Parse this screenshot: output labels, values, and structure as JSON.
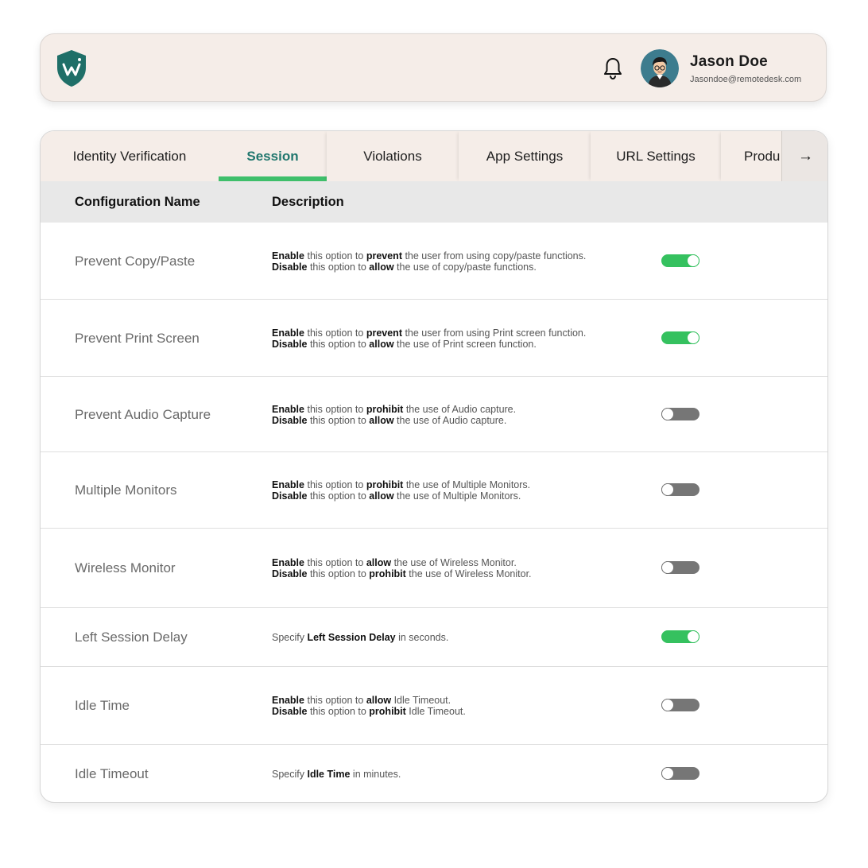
{
  "header": {
    "logo_icon": "shield-w-logo",
    "notification_icon": "bell-icon",
    "user": {
      "name": "Jason Doe",
      "email": "Jasondoe@remotedesk.com"
    }
  },
  "tabs": [
    {
      "label": "Identity Verification",
      "active": false
    },
    {
      "label": "Session",
      "active": true
    },
    {
      "label": "Violations",
      "active": false
    },
    {
      "label": "App Settings",
      "active": false
    },
    {
      "label": "URL Settings",
      "active": false
    },
    {
      "label": "Produ",
      "active": false
    }
  ],
  "tab_scroll_arrow": "→",
  "table": {
    "headers": {
      "name": "Configuration Name",
      "description": "Description"
    },
    "rows": [
      {
        "name": "Prevent Copy/Paste",
        "line1": {
          "a": "Enable",
          "b": " this option to ",
          "c": "prevent",
          "d": " the user from using copy/paste functions."
        },
        "line2": {
          "a": "Disable",
          "b": " this option to ",
          "c": "allow",
          "d": " the use of copy/paste functions."
        },
        "enabled": true
      },
      {
        "name": "Prevent Print Screen",
        "line1": {
          "a": "Enable",
          "b": " this option to ",
          "c": "prevent",
          "d": " the user from using Print screen function."
        },
        "line2": {
          "a": "Disable",
          "b": " this option to ",
          "c": "allow",
          "d": " the use of Print screen function."
        },
        "enabled": true
      },
      {
        "name": "Prevent Audio Capture",
        "line1": {
          "a": "Enable",
          "b": " this option to ",
          "c": "prohibit",
          "d": " the use of Audio capture."
        },
        "line2": {
          "a": "Disable",
          "b": " this option to ",
          "c": "allow",
          "d": " the use of Audio capture."
        },
        "enabled": false
      },
      {
        "name": "Multiple Monitors",
        "line1": {
          "a": "Enable",
          "b": " this option to ",
          "c": "prohibit",
          "d": " the use of Multiple Monitors."
        },
        "line2": {
          "a": "Disable",
          "b": " this option to ",
          "c": "allow",
          "d": " the use of Multiple Monitors."
        },
        "enabled": false
      },
      {
        "name": "Wireless Monitor",
        "line1": {
          "a": "Enable",
          "b": " this option to ",
          "c": "allow",
          "d": " the use of Wireless Monitor."
        },
        "line2": {
          "a": "Disable",
          "b": " this option to ",
          "c": "prohibit",
          "d": " the use of Wireless Monitor."
        },
        "enabled": false
      },
      {
        "name": "Left Session Delay",
        "line1": {
          "a": "Specify ",
          "b": "Left Session Delay",
          "c": " in seconds."
        },
        "enabled": true
      },
      {
        "name": "Idle Time",
        "line1": {
          "a": "Enable",
          "b": " this option to ",
          "c": "allow",
          "d": " Idle Timeout."
        },
        "line2": {
          "a": "Disable",
          "b": " this option to ",
          "c": "prohibit",
          "d": " Idle Timeout."
        },
        "enabled": false
      },
      {
        "name": "Idle Timeout",
        "line1": {
          "a": "Specify ",
          "b": "Idle Time",
          "c": " in minutes."
        },
        "enabled": false
      }
    ]
  },
  "colors": {
    "accent_teal": "#21776e",
    "active_underline": "#3fbf6b",
    "toggle_on": "#35c15f",
    "toggle_off": "#767676",
    "header_bg": "#f5ede8"
  }
}
